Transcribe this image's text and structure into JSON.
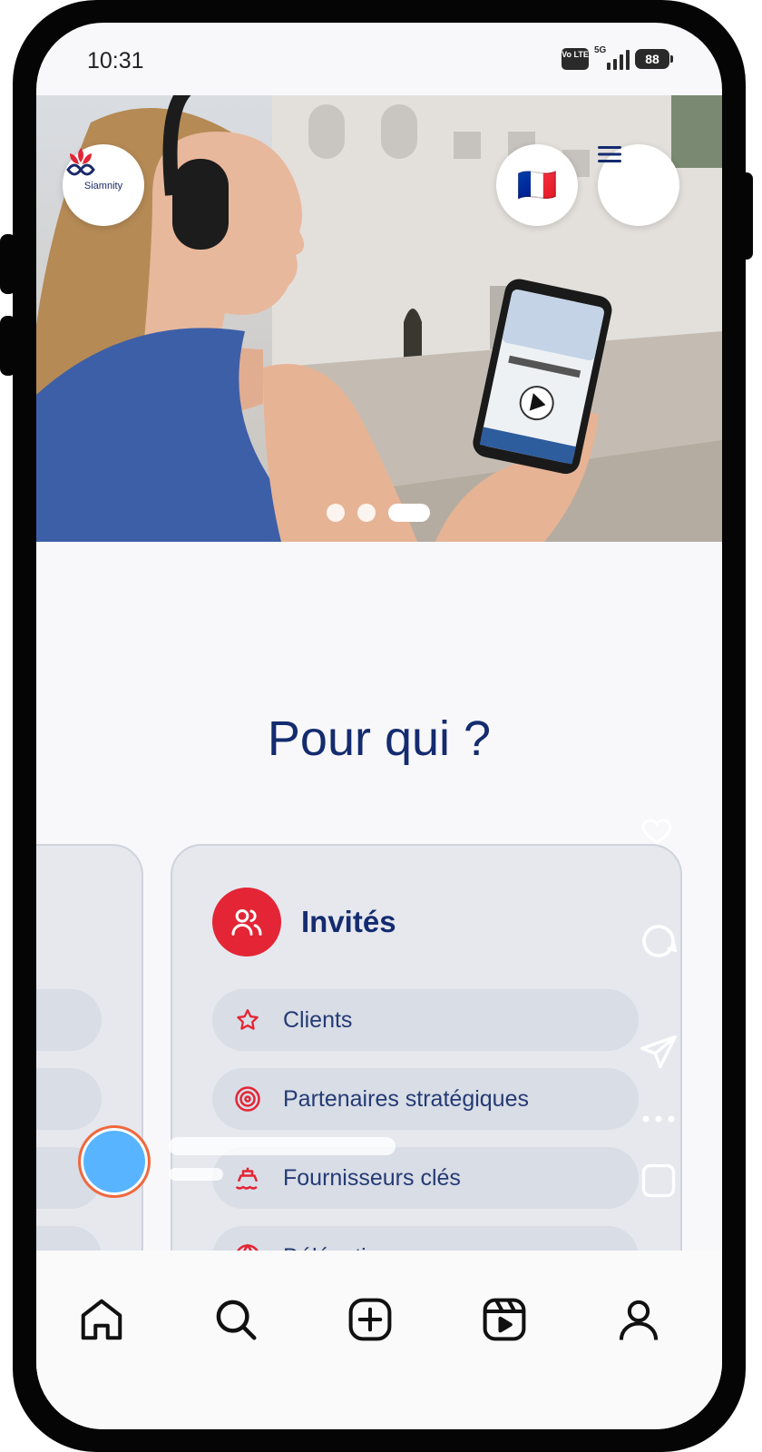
{
  "status_bar": {
    "time": "10:31",
    "network_badge": "Vo LTE",
    "network_type": "5G",
    "battery": "88"
  },
  "header": {
    "logo_text": "Siamnity",
    "language_flag": "🇫🇷",
    "menu_icon": "hamburger-icon"
  },
  "carousel": {
    "slide_count": 3,
    "active_index": 2
  },
  "section": {
    "title": "Pour qui ?"
  },
  "audience_card": {
    "title": "Invités",
    "icon": "users-icon",
    "items": [
      {
        "label": "Clients",
        "icon": "star-icon"
      },
      {
        "label": "Partenaires stratégiques",
        "icon": "target-icon"
      },
      {
        "label": "Fournisseurs clés",
        "icon": "ship-icon"
      },
      {
        "label": "Délégations",
        "icon": "globe-icon"
      }
    ]
  },
  "bottom_nav": {
    "items": [
      "home-icon",
      "search-icon",
      "create-icon",
      "reels-icon",
      "profile-icon"
    ]
  },
  "colors": {
    "brand_navy": "#142b6f",
    "accent_red": "#e42535",
    "card_bg": "#e6e8ee",
    "pill_bg": "#d8dde6"
  }
}
